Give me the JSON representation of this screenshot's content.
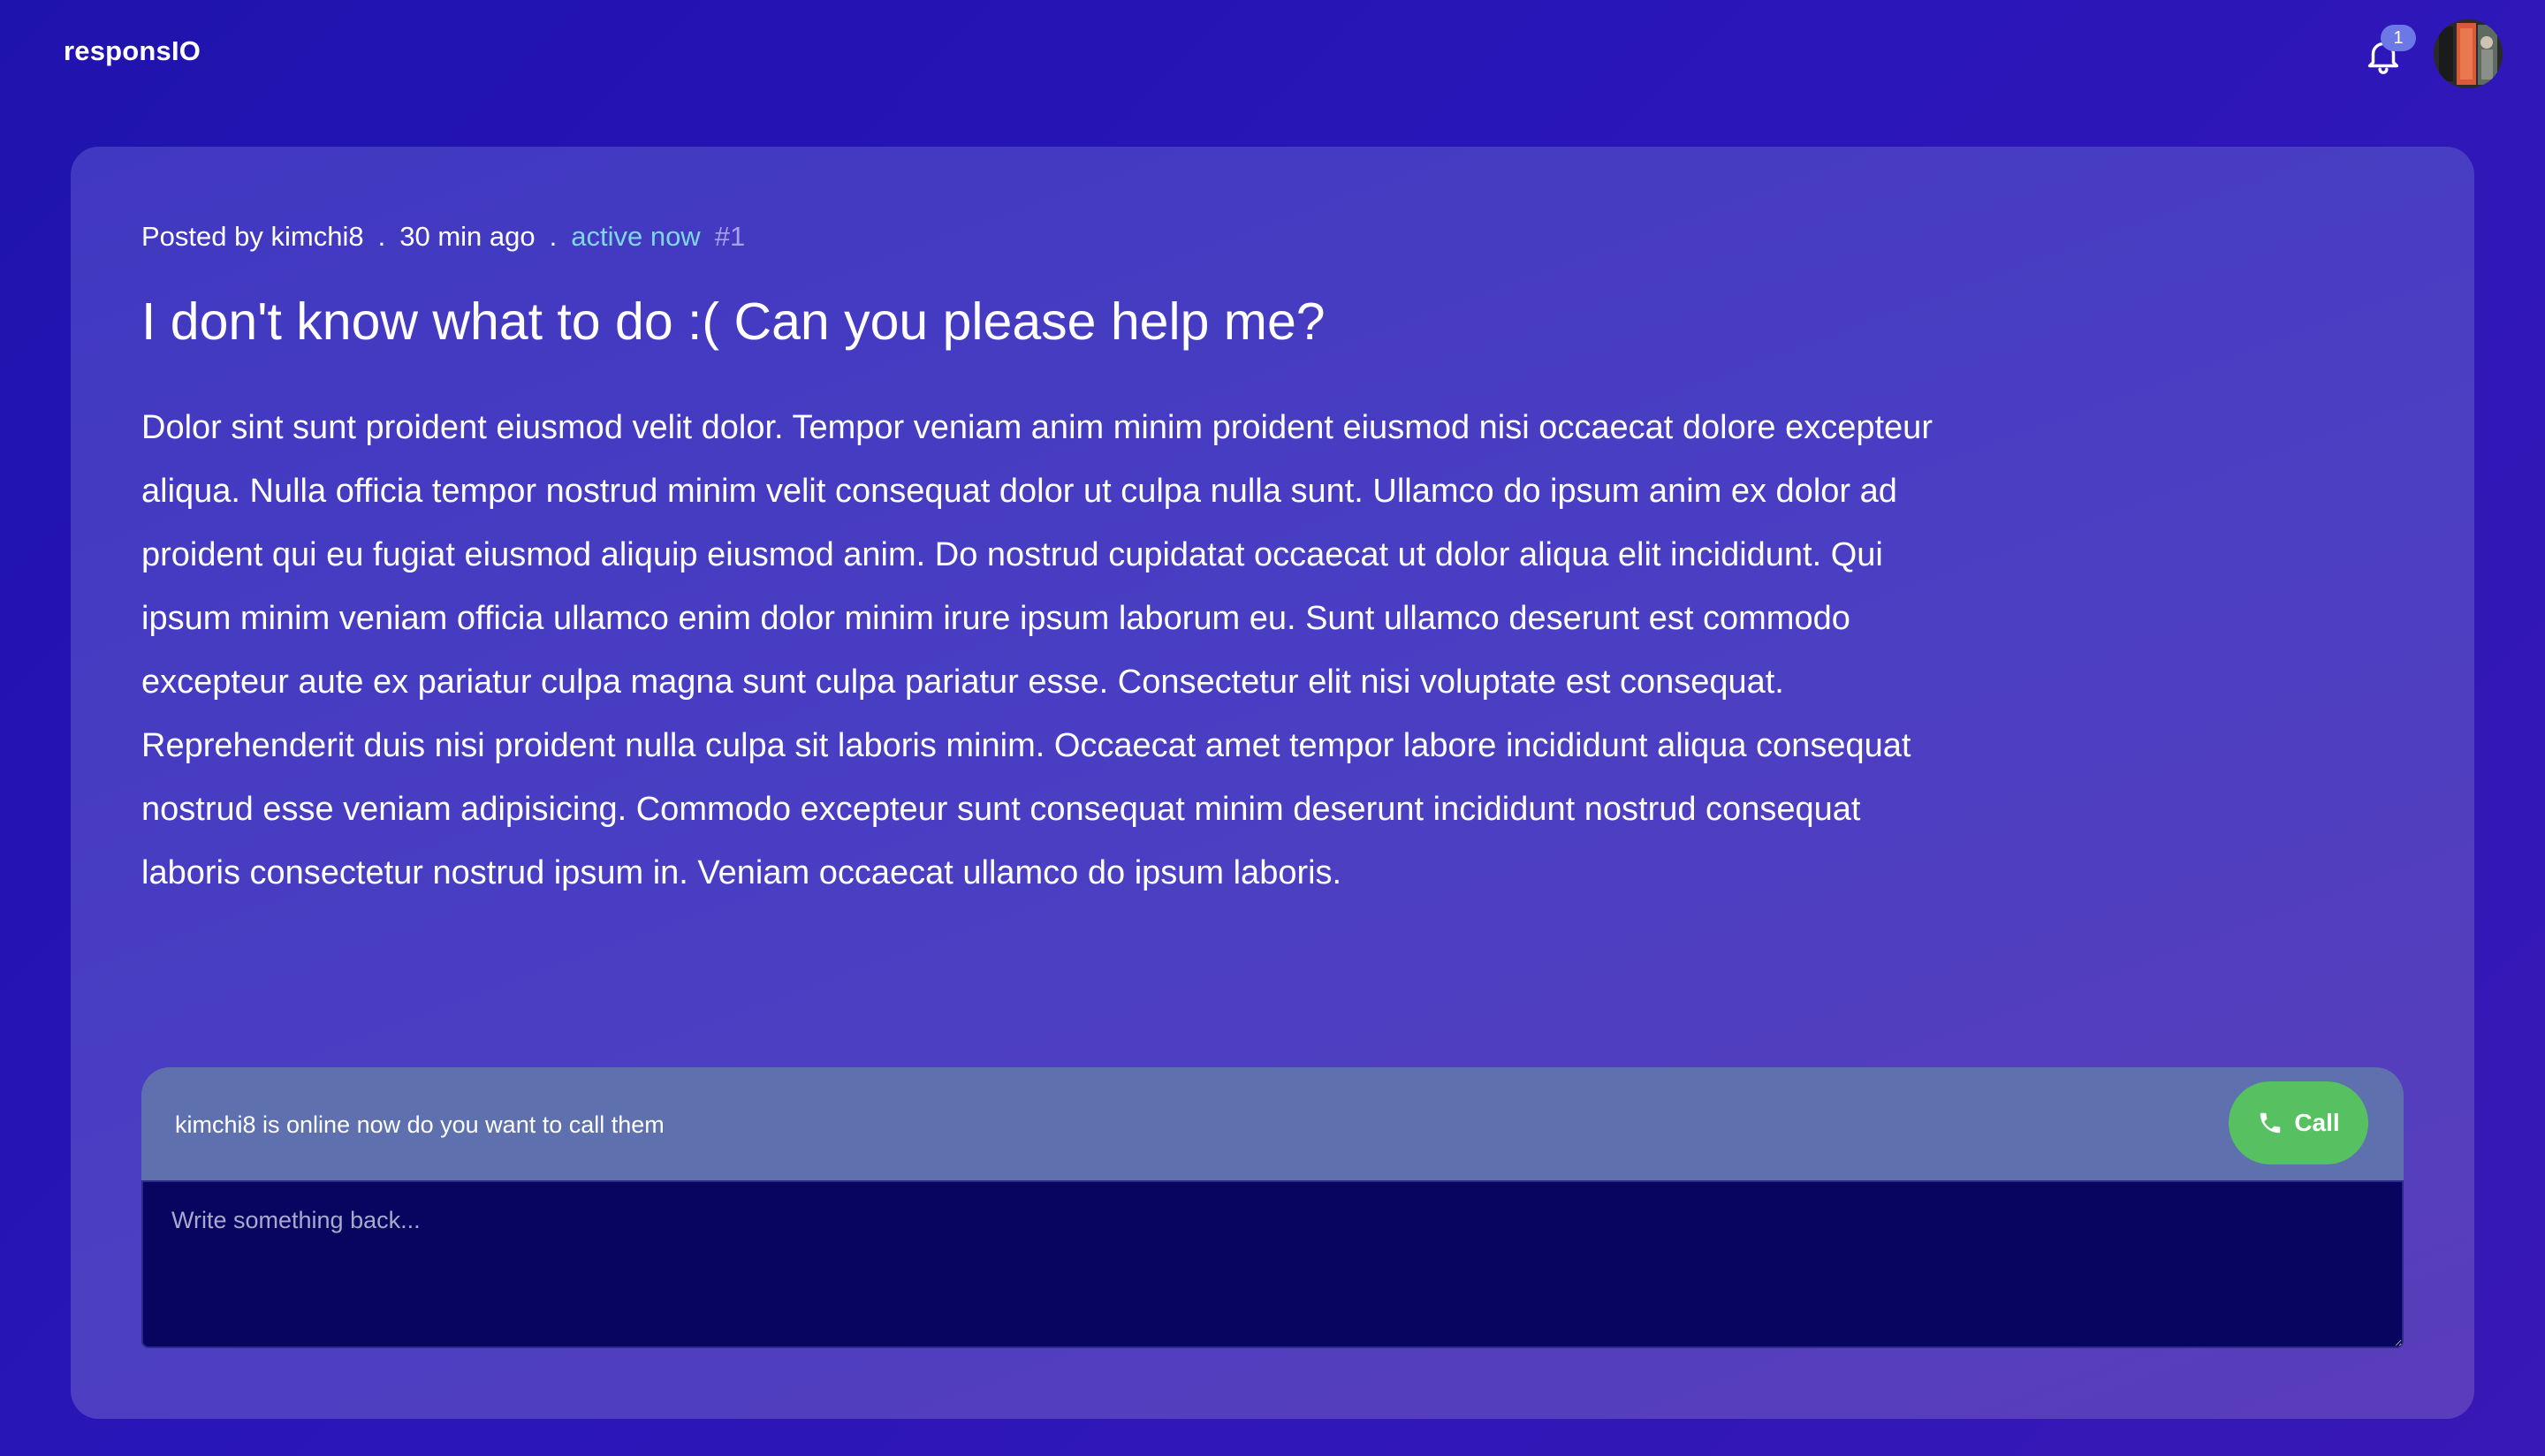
{
  "header": {
    "logo": "responsIO",
    "notification_count": "1",
    "notification_icon": "bell-icon",
    "avatar_icon": "user-avatar"
  },
  "post": {
    "posted_by_label": "Posted by",
    "author": "kimchi8",
    "time_ago": "30 min ago",
    "separator": ".",
    "status": "active now",
    "post_number": "#1",
    "title": "I don't know what to do :( Can you please help me?",
    "body": "Dolor sint sunt proident eiusmod velit dolor. Tempor veniam anim minim proident eiusmod nisi occaecat dolore excepteur aliqua. Nulla officia tempor nostrud minim velit consequat dolor ut culpa nulla sunt. Ullamco do ipsum anim ex dolor ad proident qui eu fugiat eiusmod aliquip eiusmod anim. Do nostrud cupidatat occaecat ut dolor aliqua elit incididunt. Qui ipsum minim veniam officia ullamco enim dolor minim irure ipsum laborum eu. Sunt ullamco deserunt est commodo excepteur aute ex pariatur culpa magna sunt culpa pariatur esse. Consectetur elit nisi voluptate est consequat. Reprehenderit duis nisi proident nulla culpa sit laboris minim. Occaecat amet tempor labore incididunt aliqua consequat nostrud esse veniam adipisicing. Commodo excepteur sunt consequat minim deserunt incididunt nostrud consequat laboris consectetur nostrud ipsum in. Veniam occaecat ullamco do ipsum laboris."
  },
  "reply": {
    "online_message": "kimchi8 is online now do you want to call them",
    "call_label": "Call",
    "call_icon": "phone-icon",
    "placeholder": "Write something back...",
    "value": ""
  },
  "colors": {
    "background": "#2316b3",
    "card": "#4a3fc3",
    "online_bar": "#5e70ad",
    "call_button": "#57c162",
    "reply_box": "#07055f",
    "active_status": "#7fd6e6"
  }
}
